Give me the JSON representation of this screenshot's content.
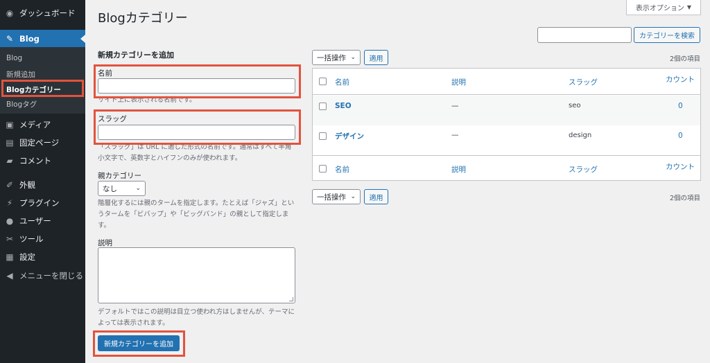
{
  "sidebar": {
    "items": [
      {
        "label": "ダッシュボード",
        "icon": "dashboard-icon",
        "glyph": "◉"
      },
      {
        "label": "Blog",
        "icon": "pin-icon",
        "glyph": "✎"
      },
      {
        "label": "メディア",
        "icon": "media-icon",
        "glyph": "▣"
      },
      {
        "label": "固定ページ",
        "icon": "page-icon",
        "glyph": "▤"
      },
      {
        "label": "コメント",
        "icon": "comment-icon",
        "glyph": "▰"
      },
      {
        "label": "外観",
        "icon": "appearance-icon",
        "glyph": "✐"
      },
      {
        "label": "プラグイン",
        "icon": "plugin-icon",
        "glyph": "⚡"
      },
      {
        "label": "ユーザー",
        "icon": "user-icon",
        "glyph": "●"
      },
      {
        "label": "ツール",
        "icon": "tool-icon",
        "glyph": "✂"
      },
      {
        "label": "設定",
        "icon": "settings-icon",
        "glyph": "▦"
      },
      {
        "label": "メニューを閉じる",
        "icon": "collapse-icon",
        "glyph": "◀"
      }
    ],
    "submenu": [
      "Blog",
      "新規追加",
      "Blogカテゴリー",
      "Blogタグ"
    ]
  },
  "header": {
    "title": "Blogカテゴリー",
    "screen_options": "表示オプション",
    "search_button": "カテゴリーを検索"
  },
  "form": {
    "heading": "新規カテゴリーを追加",
    "name_label": "名前",
    "name_desc": "サイト上に表示される名前です。",
    "slug_label": "スラッグ",
    "slug_desc": "「スラッグ」は URL に適した形式の名前です。通常はすべて半角小文字で、英数字とハイフンのみが使われます。",
    "parent_label": "親カテゴリー",
    "parent_value": "なし",
    "parent_desc": "階層化するには親のタームを指定します。たとえば「ジャズ」というタームを「ビバップ」や「ビッグバンド」の親として指定します。",
    "description_label": "説明",
    "description_desc": "デフォルトではこの説明は目立つ使われ方はしませんが、テーマによっては表示されます。",
    "submit": "新規カテゴリーを追加"
  },
  "list": {
    "bulk_action": "一括操作",
    "apply": "適用",
    "count": "2個の項目",
    "columns": {
      "name": "名前",
      "description": "説明",
      "slug": "スラッグ",
      "count": "カウント"
    },
    "rows": [
      {
        "name": "SEO",
        "description": "—",
        "slug": "seo",
        "count": "0"
      },
      {
        "name": "デザイン",
        "description": "—",
        "slug": "design",
        "count": "0"
      }
    ]
  },
  "colors": {
    "accent": "#2271b1",
    "highlight": "#e2533d",
    "sidebar": "#1d2327"
  }
}
